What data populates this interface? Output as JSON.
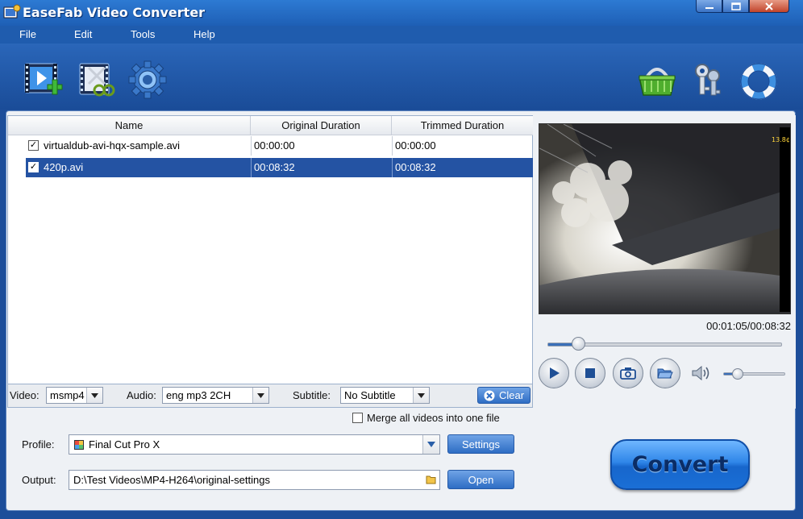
{
  "window": {
    "title": "EaseFab Video Converter"
  },
  "menu": {
    "items": [
      "File",
      "Edit",
      "Tools",
      "Help"
    ]
  },
  "toolbar": {
    "left_icons": [
      "add-video-icon",
      "edit-video-icon",
      "settings-gear-icon"
    ],
    "right_icons": [
      "shopping-basket-icon",
      "keys-icon",
      "lifebuoy-icon"
    ]
  },
  "file_list": {
    "columns": [
      "Name",
      "Original Duration",
      "Trimmed Duration"
    ],
    "rows": [
      {
        "checked": true,
        "name": "virtualdub-avi-hqx-sample.avi",
        "original": "00:00:00",
        "trimmed": "00:00:00",
        "selected": false
      },
      {
        "checked": true,
        "name": "420p.avi",
        "original": "00:08:32",
        "trimmed": "00:08:32",
        "selected": true
      }
    ]
  },
  "tracks": {
    "video_label": "Video:",
    "video_value": "msmp4",
    "audio_label": "Audio:",
    "audio_value": "eng mp3 2CH",
    "subtitle_label": "Subtitle:",
    "subtitle_value": "No Subtitle",
    "clear_label": "Clear"
  },
  "preview": {
    "overlay_text": "13.8¢",
    "timecode": "00:01:05/00:08:32",
    "seek_fraction": 0.13,
    "volume_fraction": 0.22,
    "controls": [
      "play-icon",
      "stop-icon",
      "snapshot-icon",
      "open-folder-icon",
      "volume-icon"
    ]
  },
  "output_settings": {
    "merge_label": "Merge all videos into one file",
    "merge_checked": false,
    "profile_label": "Profile:",
    "profile_value": "Final Cut Pro X",
    "settings_button": "Settings",
    "output_label": "Output:",
    "output_path": "D:\\Test Videos\\MP4-H264\\original-settings",
    "open_button": "Open",
    "convert_button": "Convert"
  },
  "colors": {
    "chrome_blue": "#1f5cae",
    "selection": "#2453a3",
    "button_blue": "#2e6dc4"
  }
}
